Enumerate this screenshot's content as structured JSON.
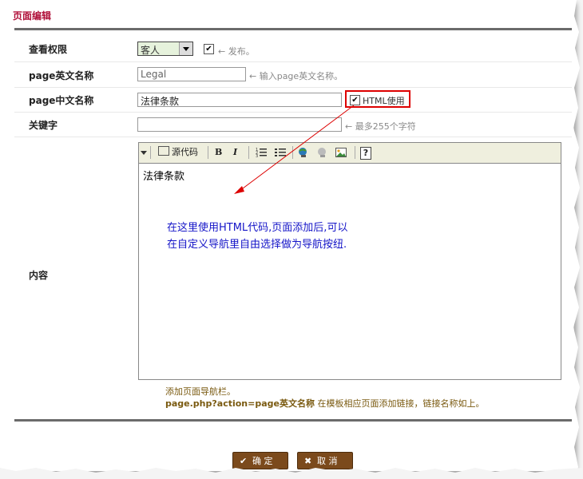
{
  "page_title": "页面编辑",
  "fields": {
    "permission": {
      "label": "查看权限",
      "selected": "客人",
      "publish_checked": "✔",
      "publish_hint": "← 发布。"
    },
    "english_name": {
      "label": "page英文名称",
      "value": "Legal",
      "hint": "← 输入page英文名称。"
    },
    "chinese_name": {
      "label": "page中文名称",
      "value": "法律条款",
      "html_use_checked": "✔",
      "html_use_label": "HTML使用"
    },
    "keywords": {
      "label": "关键字",
      "value": "",
      "hint": "← 最多255个字符"
    },
    "content": {
      "label": "内容"
    }
  },
  "toolbar": {
    "source_label": "源代码",
    "bold_label": "B",
    "italic_label": "I",
    "ordered_list_icon": "ordered-list-icon",
    "unordered_list_icon": "unordered-list-icon",
    "link_icon": "link-icon",
    "unlink_icon": "unlink-icon",
    "image_icon": "image-icon",
    "help_label": "?"
  },
  "editor": {
    "content": "法律条款"
  },
  "annotation": {
    "line1": "在这里使用HTML代码,页面添加后,可以",
    "line2": "在自定义导航里自由选择做为导航按纽."
  },
  "footer": {
    "line1": "添加页面导航栏。",
    "line2_code": "page.php?action=page英文名称",
    "line2_text": " 在模板相应页面添加链接，链接名称如上。"
  },
  "buttons": {
    "confirm_label": "确 定",
    "cancel_label": "取 消",
    "confirm_icon": "✔",
    "cancel_icon": "✖"
  },
  "colors": {
    "title": "#b0103a",
    "annotation": "#1515c8",
    "highlight_box": "#dd0000",
    "button": "#7b4a1c"
  }
}
